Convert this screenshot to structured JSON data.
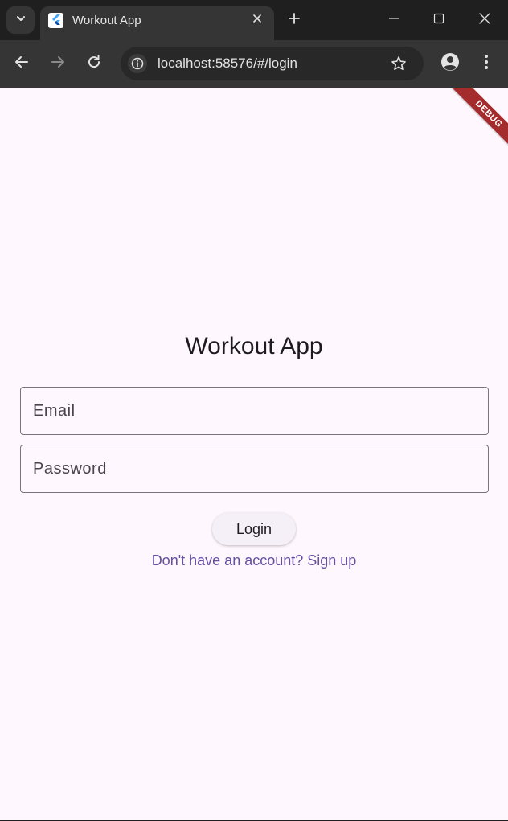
{
  "browser": {
    "tab": {
      "title": "Workout App"
    },
    "address_bar": {
      "url": "localhost:58576/#/login"
    }
  },
  "app": {
    "debug_banner": "DEBUG",
    "title": "Workout App",
    "email_field": {
      "placeholder": "Email"
    },
    "password_field": {
      "placeholder": "Password"
    },
    "login_button": "Login",
    "signup_link": "Don't have an account? Sign up"
  },
  "icons": {
    "tab_search": "chevron-down-icon",
    "tab_favicon": "flutter-icon",
    "tab_close": "close-icon",
    "new_tab": "plus-icon",
    "minimize": "minimize-icon",
    "maximize": "maximize-icon",
    "window_close": "close-icon",
    "back": "arrow-left-icon",
    "forward": "arrow-right-icon",
    "reload": "reload-icon",
    "site_info": "info-icon",
    "bookmark": "star-icon",
    "profile": "profile-icon",
    "menu": "kebab-menu-icon"
  },
  "colors": {
    "app_background": "#fef7fd",
    "primary": "#6750a4",
    "debug_banner": "#a52c2c"
  }
}
